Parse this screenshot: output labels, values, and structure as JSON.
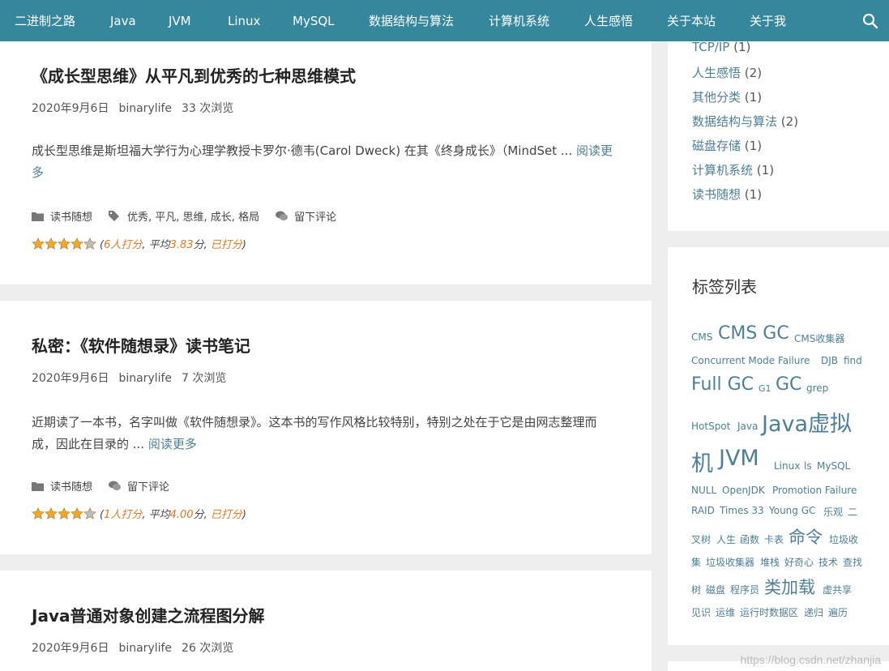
{
  "nav": {
    "items": [
      "二进制之路",
      "Java",
      "JVM",
      "Linux",
      "MySQL",
      "数据结构与算法",
      "计算机系统",
      "人生感悟",
      "关于本站",
      "关于我"
    ]
  },
  "posts": [
    {
      "title": "《成长型思维》从平凡到优秀的七种思维模式",
      "date": "2020年9月6日",
      "author": "binarylife",
      "views": "33 次浏览",
      "excerpt": "成长型思维是斯坦福大学行为心理学教授卡罗尔·德韦(Carol Dweck) 在其《终身成长》（MindSet ...",
      "read_more": "阅读更多",
      "category": "读书随想",
      "tags": "优秀, 平凡, 思维, 成长, 格局",
      "comment": "留下评论",
      "rating": {
        "score": 3.83,
        "stars_filled": 3.83,
        "open": "(",
        "count": "6人打分",
        "sep": ", 平均",
        "avg": "3.83",
        "unit": "分, ",
        "status": "已打分",
        "close": ")"
      }
    },
    {
      "title": "私密：《软件随想录》读书笔记",
      "date": "2020年9月6日",
      "author": "binarylife",
      "views": "7 次浏览",
      "excerpt": "近期读了一本书，名字叫做《软件随想录》。这本书的写作风格比较特别，特别之处在于它是由网志整理而成，因此在目录的 ...",
      "read_more": "阅读更多",
      "category": "读书随想",
      "comment": "留下评论",
      "rating": {
        "score": 4.0,
        "stars_filled": 4.0,
        "open": "(",
        "count": "1人打分",
        "sep": ", 平均",
        "avg": "4.00",
        "unit": "分, ",
        "status": "已打分",
        "close": ")"
      }
    },
    {
      "title": "Java普通对象创建之流程图分解",
      "date": "2020年9月6日",
      "author": "binarylife",
      "views": "26 次浏览"
    }
  ],
  "categories": [
    {
      "name": "TCP/IP",
      "count": "(1)"
    },
    {
      "name": "人生感悟",
      "count": "(2)"
    },
    {
      "name": "其他分类",
      "count": "(1)"
    },
    {
      "name": "数据结构与算法",
      "count": "(2)"
    },
    {
      "name": "磁盘存储",
      "count": "(1)"
    },
    {
      "name": "计算机系统",
      "count": "(1)"
    },
    {
      "name": "读书随想",
      "count": "(1)"
    }
  ],
  "tag_widget": {
    "title": "标签列表",
    "tags": [
      "CMS",
      "CMS GC",
      "CMS收集器",
      "Concurrent Mode Failure",
      "DJB",
      "find",
      "Full GC",
      "G1",
      "GC",
      "grep",
      "HotSpot",
      "Java",
      "Java虚拟",
      "机",
      "JVM",
      "Linux",
      "ls",
      "MySQL",
      "NULL",
      "OpenJDK",
      "Promotion Failure",
      "RAID",
      "Times 33",
      "Young GC",
      "乐观",
      "二",
      "叉树",
      "人生",
      "函数",
      "卡表",
      "命令",
      "垃圾收",
      "集",
      "垃圾收集器",
      "堆栈",
      "好奇心",
      "技术",
      "查找",
      "树",
      "磁盘",
      "程序员",
      "类加载",
      "虚共享",
      "见识",
      "运维",
      "运行时数据区",
      "递归",
      "遍历"
    ]
  },
  "watermark": "https://blog.csdn.net/zhanjia",
  "colors": {
    "nav_bg": "#34879c",
    "link": "#4d7f96",
    "accent": "#e27920",
    "star": "#f5a623"
  }
}
